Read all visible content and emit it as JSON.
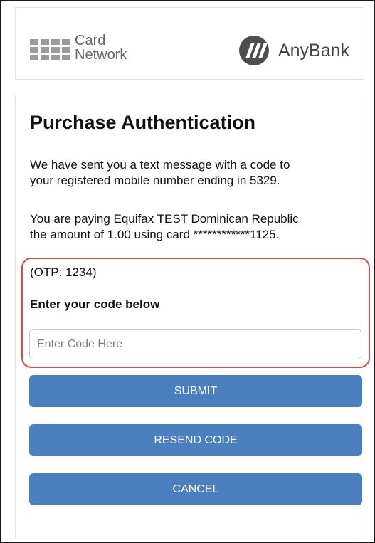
{
  "header": {
    "card_network": {
      "line1": "Card",
      "line2": "Network"
    },
    "bank_name": "AnyBank",
    "icons": {
      "card_network": "card-network-grid-icon",
      "bank": "anybank-slash-icon"
    }
  },
  "main": {
    "title": "Purchase Authentication",
    "message_line1": "We have sent you a text message with a code to",
    "message_line2": "your registered mobile number ending in 5329.",
    "payment_line1": "You are paying Equifax TEST Dominican Republic",
    "payment_line2": "the amount of 1.00 using card ************1125.",
    "otp_hint": "(OTP: 1234)",
    "code_label": "Enter your code below",
    "code_input": {
      "placeholder": "Enter Code Here",
      "value": ""
    }
  },
  "buttons": {
    "submit": "SUBMIT",
    "resend": "RESEND CODE",
    "cancel": "CANCEL"
  },
  "colors": {
    "button_bg": "#4a7fc1",
    "highlight_border": "#e0454b",
    "logo_gray": "#9b9b9b"
  }
}
